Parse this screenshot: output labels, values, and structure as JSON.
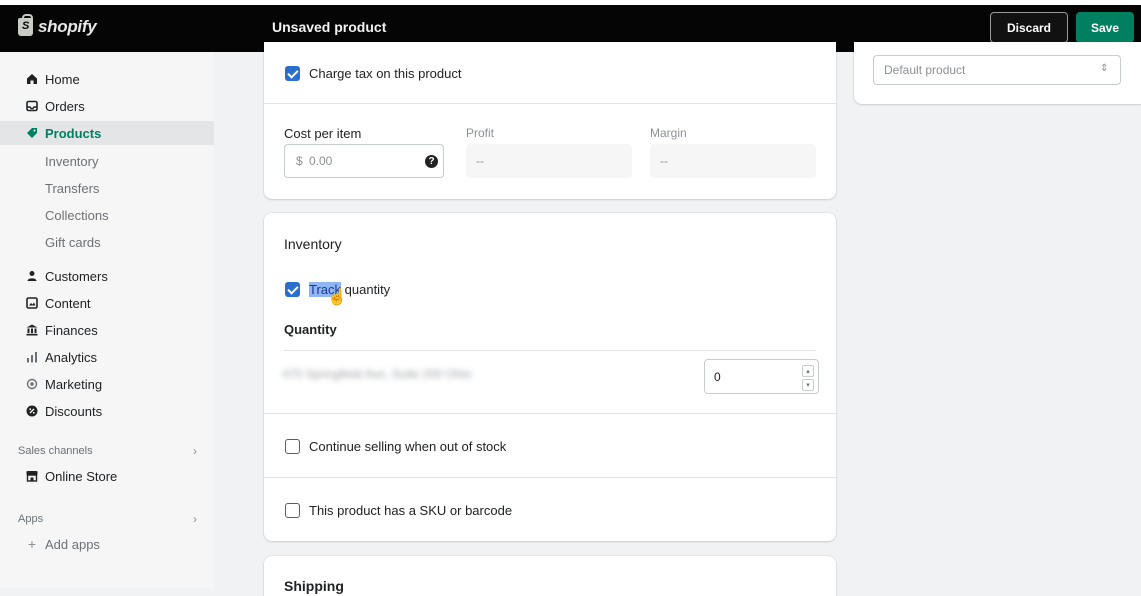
{
  "app": {
    "logo_text": "shopify",
    "page_title": "Unsaved product"
  },
  "actions": {
    "discard_label": "Discard",
    "save_label": "Save"
  },
  "sidebar": {
    "items": [
      {
        "label": "Home",
        "icon": "home-icon"
      },
      {
        "label": "Orders",
        "icon": "orders-icon"
      },
      {
        "label": "Products",
        "icon": "tag-icon",
        "active": true
      },
      {
        "label": "Customers",
        "icon": "person-icon"
      },
      {
        "label": "Content",
        "icon": "content-icon"
      },
      {
        "label": "Finances",
        "icon": "bank-icon"
      },
      {
        "label": "Analytics",
        "icon": "bar-chart-icon"
      },
      {
        "label": "Marketing",
        "icon": "target-icon"
      },
      {
        "label": "Discounts",
        "icon": "discount-icon"
      }
    ],
    "product_subitems": [
      "Inventory",
      "Transfers",
      "Collections",
      "Gift cards"
    ],
    "sales_channels_label": "Sales channels",
    "online_store_label": "Online Store",
    "apps_label": "Apps",
    "add_apps_label": "Add apps"
  },
  "pricing": {
    "charge_tax_label": "Charge tax on this product",
    "charge_tax_checked": true,
    "cost_label": "Cost per item",
    "cost_prefix": "$",
    "cost_placeholder": "0.00",
    "profit_label": "Profit",
    "profit_value": "--",
    "margin_label": "Margin",
    "margin_value": "--"
  },
  "inventory": {
    "title": "Inventory",
    "track_label_highlighted": "Track",
    "track_label_rest": " quantity",
    "track_checked": true,
    "quantity_heading": "Quantity",
    "location_blurred": "470 Springfield Ave, Suite 200 Ohio",
    "quantity_value": "0",
    "continue_selling_label": "Continue selling when out of stock",
    "continue_selling_checked": false,
    "sku_label": "This product has a SKU or barcode",
    "sku_checked": false
  },
  "shipping": {
    "title": "Shipping"
  },
  "right_panel": {
    "select_value": "Default product"
  },
  "colors": {
    "accent_green": "#008060",
    "checkbox_blue": "#2c6ecb",
    "topbar": "#050505"
  }
}
